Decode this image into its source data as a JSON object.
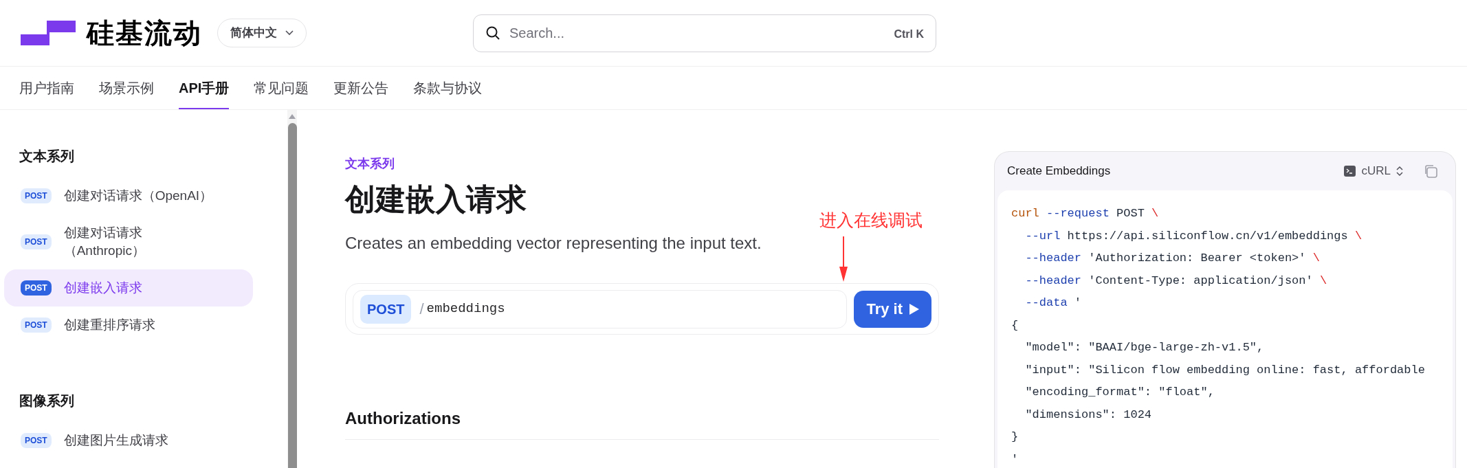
{
  "header": {
    "brand": "硅基流动",
    "language": "简体中文",
    "search": {
      "placeholder": "Search...",
      "shortcut": "Ctrl K"
    }
  },
  "nav_tabs": [
    {
      "label": "用户指南",
      "selected": false
    },
    {
      "label": "场景示例",
      "selected": false
    },
    {
      "label": "API手册",
      "selected": true
    },
    {
      "label": "常见问题",
      "selected": false
    },
    {
      "label": "更新公告",
      "selected": false
    },
    {
      "label": "条款与协议",
      "selected": false
    }
  ],
  "sidebar": {
    "groups": [
      {
        "title": "文本系列",
        "items": [
          {
            "method": "POST",
            "label": "创建对话请求（OpenAI）",
            "selected": false
          },
          {
            "method": "POST",
            "label": "创建对话请求（Anthropic）",
            "selected": false
          },
          {
            "method": "POST",
            "label": "创建嵌入请求",
            "selected": true
          },
          {
            "method": "POST",
            "label": "创建重排序请求",
            "selected": false
          }
        ]
      },
      {
        "title": "图像系列",
        "items": [
          {
            "method": "POST",
            "label": "创建图片生成请求",
            "selected": false
          }
        ]
      }
    ]
  },
  "main": {
    "breadcrumb": "文本系列",
    "title": "创建嵌入请求",
    "description": "Creates an embedding vector representing the input text.",
    "endpoint": {
      "method": "POST",
      "separator": "/",
      "path": "embeddings",
      "button": "Try it"
    },
    "annotation": "进入在线调试",
    "sections": [
      "Authorizations"
    ]
  },
  "code_panel": {
    "title": "Create Embeddings",
    "language": "cURL",
    "lines": [
      {
        "tokens": [
          {
            "kind": "command",
            "text": "curl"
          },
          {
            "kind": "flag",
            "text": " --request"
          },
          {
            "kind": "text",
            "text": " POST "
          },
          {
            "kind": "escape",
            "text": "\\"
          }
        ]
      },
      {
        "tokens": [
          {
            "kind": "flag",
            "text": "  --url"
          },
          {
            "kind": "text",
            "text": " https://api.siliconflow.cn/v1/embeddings "
          },
          {
            "kind": "escape",
            "text": "\\"
          }
        ]
      },
      {
        "tokens": [
          {
            "kind": "flag",
            "text": "  --header"
          },
          {
            "kind": "text",
            "text": " 'Authorization: Bearer <token>' "
          },
          {
            "kind": "escape",
            "text": "\\"
          }
        ]
      },
      {
        "tokens": [
          {
            "kind": "flag",
            "text": "  --header"
          },
          {
            "kind": "text",
            "text": " 'Content-Type: application/json' "
          },
          {
            "kind": "escape",
            "text": "\\"
          }
        ]
      },
      {
        "tokens": [
          {
            "kind": "flag",
            "text": "  --data"
          },
          {
            "kind": "text",
            "text": " '"
          }
        ]
      },
      {
        "tokens": [
          {
            "kind": "text",
            "text": "{"
          }
        ]
      },
      {
        "tokens": [
          {
            "kind": "text",
            "text": "  \"model\": \"BAAI/bge-large-zh-v1.5\","
          }
        ]
      },
      {
        "tokens": [
          {
            "kind": "text",
            "text": "  \"input\": \"Silicon flow embedding online: fast, affordable"
          }
        ]
      },
      {
        "tokens": [
          {
            "kind": "text",
            "text": "  \"encoding_format\": \"float\","
          }
        ]
      },
      {
        "tokens": [
          {
            "kind": "text",
            "text": "  \"dimensions\": 1024"
          }
        ]
      },
      {
        "tokens": [
          {
            "kind": "text",
            "text": "}"
          }
        ]
      },
      {
        "tokens": [
          {
            "kind": "text",
            "text": "'"
          }
        ]
      }
    ]
  }
}
